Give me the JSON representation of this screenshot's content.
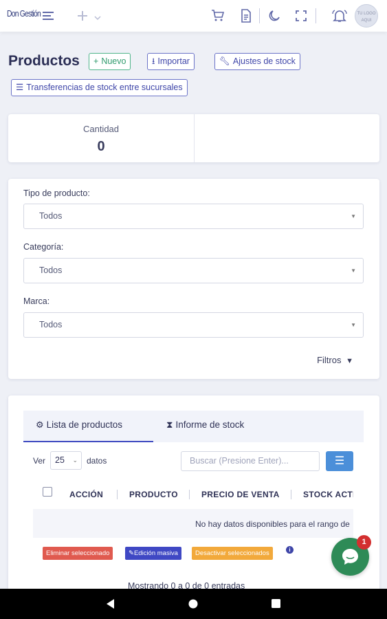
{
  "topbar": {
    "logo": "Don Gestión",
    "icons": [
      "menu-icon",
      "plus-icon",
      "chevron-down-icon",
      "cart-icon",
      "document-icon",
      "moon-icon",
      "fullscreen-icon",
      "bell-icon"
    ],
    "avatar_text": "TU LOGO AQUI"
  },
  "header": {
    "title": "Productos",
    "buttons": {
      "new": "Nuevo",
      "import": "Importar",
      "stock_adjust": "Ajustes de stock",
      "transfers": "Transferencias de stock entre sucursales"
    }
  },
  "stats": {
    "quantity_label": "Cantidad",
    "quantity_value": "0"
  },
  "filters": {
    "product_type_label": "Tipo de producto:",
    "product_type_value": "Todos",
    "category_label": "Categoría:",
    "category_value": "Todos",
    "brand_label": "Marca:",
    "brand_value": "Todos",
    "filters_link": "Filtros"
  },
  "list": {
    "tabs": [
      "Lista de productos",
      "Informe de stock"
    ],
    "show_label": "Ver",
    "page_size": "25",
    "data_label": "datos",
    "search_placeholder": "Buscar (Presione Enter)...",
    "columns": [
      "ACCIÓN",
      "PRODUCTO",
      "PRECIO DE VENTA",
      "STOCK ACTI"
    ],
    "empty_message": "No hay datos disponibles para el rango de",
    "bulk_actions": {
      "delete": "Eliminar seleccionado",
      "bulk_edit": "Edición masiva",
      "deactivate": "Desactivar seleccionados"
    },
    "footer": "Mostrando 0 a 0 de 0 entradas"
  },
  "chat": {
    "badge_count": "1"
  },
  "colors": {
    "accent": "#3e45a8",
    "green": "#2f9a6c",
    "delete": "#e05a4f",
    "edit": "#3f48c4",
    "deactivate": "#f2a93b",
    "chat": "#2e8b57"
  }
}
